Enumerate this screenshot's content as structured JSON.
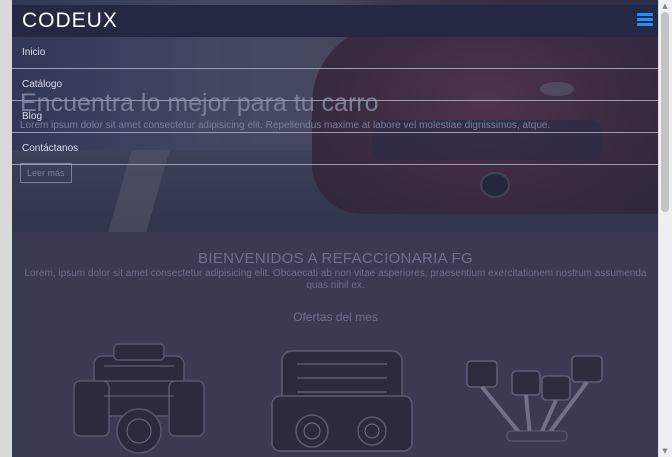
{
  "navbar": {
    "brand": "CODEUX",
    "menu_icon": "hamburger-icon",
    "menu_icon_color": "#1e90ff"
  },
  "menu": {
    "items": [
      "Inicio",
      "Catálogo",
      "Blog",
      "Contáctanos"
    ]
  },
  "hero": {
    "title": "Encuentra lo mejor para tu carro",
    "paragraph": "Lorem ipsum dolor sit amet consectetur adipisicing elit. Repellendus maxime at labore vel molestiae dignissimos, atque.",
    "button": "Leer más"
  },
  "welcome": {
    "title": "BIENVENIDOS A REFACCIONARIA FG",
    "paragraph": "Lorem, ipsum dolor sit amet consectetur adipisicing elit. Obcaecati ab non vitae asperiores, praesentium exercitationem nostrum assumenda quas nihil ex.",
    "offers_title": "Ofertas del mes"
  },
  "products": [
    {
      "icon": "v8-engine-icon"
    },
    {
      "icon": "engine-block-icon"
    },
    {
      "icon": "pistons-icon"
    }
  ]
}
